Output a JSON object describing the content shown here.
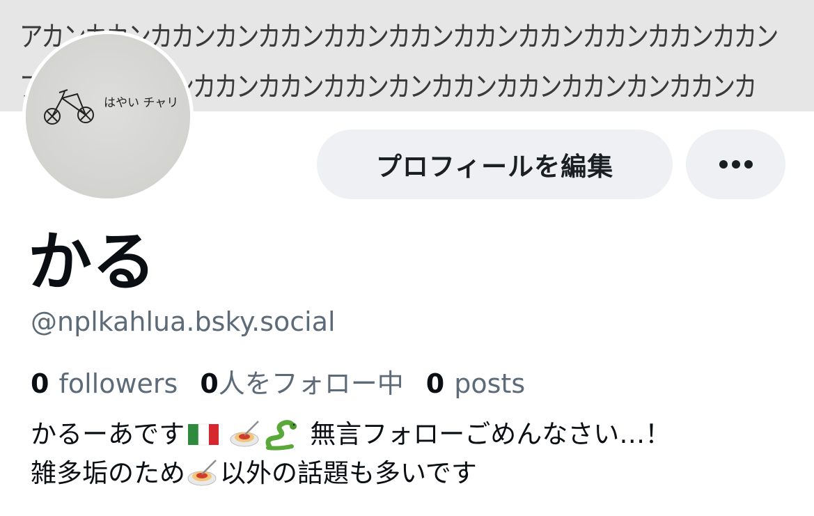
{
  "banner": {
    "line1": "アカンカカンカカンカンカカンカカンカカンカカンカカンカカンカカンカカン",
    "line2": "アカンカンカカンカカンカカンカカンカンカカンカカンカカンカンカカンカ"
  },
  "profile": {
    "display_name": "かる",
    "handle": "@nplkahlua.bsky.social",
    "avatar_text": "はやい チャリ"
  },
  "actions": {
    "edit_label": "プロフィールを編集",
    "more_icon": "ellipsis-icon"
  },
  "stats": [
    {
      "count": "0",
      "label": "followers"
    },
    {
      "count": "0",
      "label": "人をフォロー中"
    },
    {
      "count": "0",
      "label": "posts"
    }
  ],
  "bio": {
    "line1_prefix": "かるーあです",
    "line1_suffix": "無言フォローごめんなさい…！",
    "line2_prefix": "雑多垢のため",
    "line2_suffix": "以外の話題も多いです",
    "emoji_names": [
      "italy-flag-icon",
      "spaghetti-icon",
      "snake-icon"
    ]
  },
  "colors": {
    "banner_bg": "#e6e6e6",
    "button_bg": "#eef0f3",
    "muted_text": "#5d6b79",
    "primary_text": "#0b0f14"
  }
}
